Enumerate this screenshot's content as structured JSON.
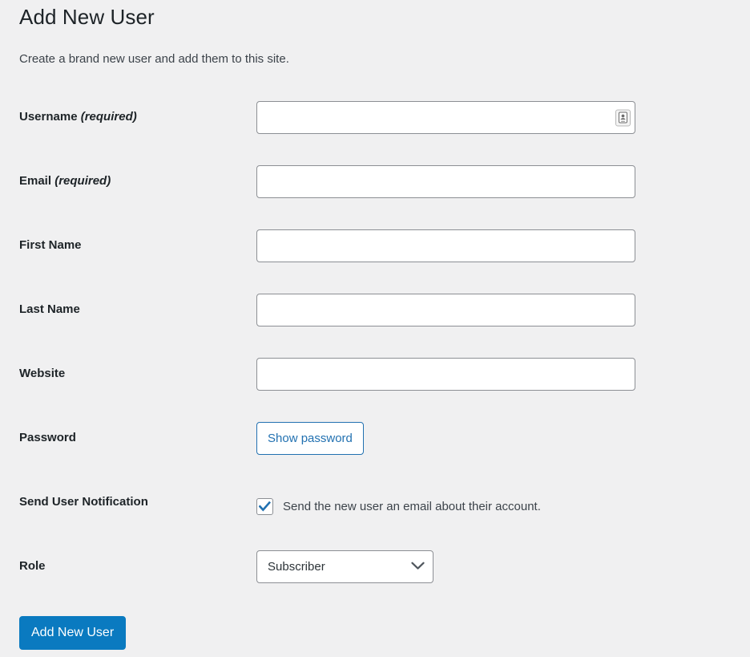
{
  "header": {
    "title": "Add New User",
    "subtitle": "Create a brand new user and add them to this site."
  },
  "form": {
    "username": {
      "label": "Username",
      "required_suffix": "(required)",
      "value": "",
      "placeholder": "",
      "autofill_icon": "contact-card-icon"
    },
    "email": {
      "label": "Email",
      "required_suffix": "(required)",
      "value": "",
      "placeholder": ""
    },
    "first_name": {
      "label": "First Name",
      "value": "",
      "placeholder": ""
    },
    "last_name": {
      "label": "Last Name",
      "value": "",
      "placeholder": ""
    },
    "website": {
      "label": "Website",
      "value": "",
      "placeholder": ""
    },
    "password": {
      "label": "Password",
      "show_password_button": "Show password"
    },
    "send_notification": {
      "label": "Send User Notification",
      "checkbox_label": "Send the new user an email about their account.",
      "checked": true
    },
    "role": {
      "label": "Role",
      "selected": "Subscriber",
      "chevron_icon": "chevron-down-icon"
    }
  },
  "submit": {
    "label": "Add New User"
  },
  "colors": {
    "page_background": "#f0f0f1",
    "primary_button": "#0a7ac0",
    "link_blue": "#2271b1",
    "heading_text": "#1d2327",
    "body_text": "#3c434a",
    "input_border": "#8c8f94"
  }
}
